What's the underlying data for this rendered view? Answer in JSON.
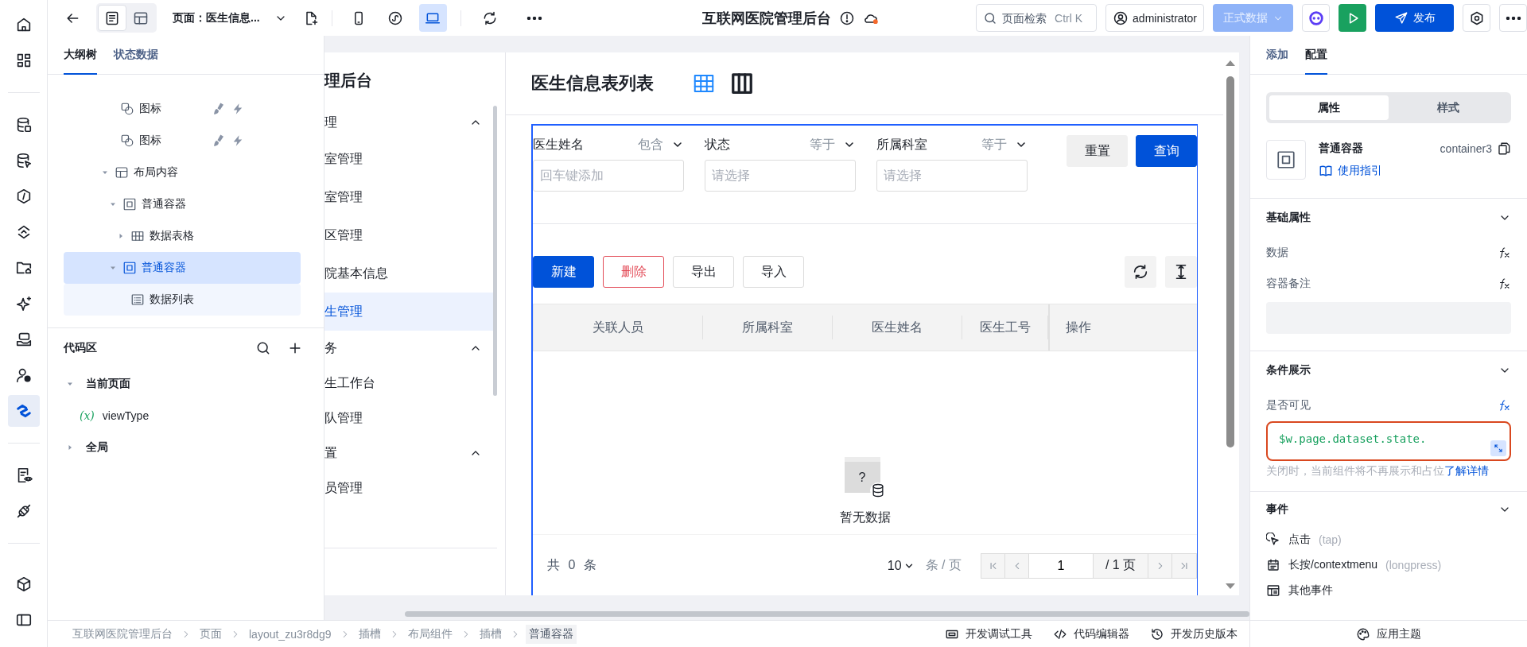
{
  "rail": {
    "groups": [
      [
        {
          "kind": "home",
          "selected": false
        },
        {
          "kind": "apps",
          "selected": false
        }
      ],
      [
        {
          "kind": "database",
          "selected": false
        },
        {
          "kind": "database-cursor",
          "selected": false
        },
        {
          "kind": "hexagon",
          "selected": false
        },
        {
          "kind": "api",
          "selected": false
        },
        {
          "kind": "folder",
          "selected": false
        },
        {
          "kind": "sparkle",
          "selected": false
        },
        {
          "kind": "hand",
          "selected": false
        },
        {
          "kind": "user",
          "selected": false
        },
        {
          "kind": "logic",
          "selected": true
        }
      ],
      [
        {
          "kind": "doc",
          "selected": false
        },
        {
          "kind": "plug",
          "selected": false
        }
      ],
      [
        {
          "kind": "cube",
          "selected": false
        },
        {
          "kind": "panel",
          "selected": false
        }
      ]
    ]
  },
  "topbar": {
    "view_modes": [
      {
        "kind": "outline",
        "selected": true
      },
      {
        "kind": "layout",
        "selected": false
      }
    ],
    "page_selector": "页面：医生信息...",
    "devices": [
      {
        "kind": "mobile",
        "selected": false
      },
      {
        "kind": "mini",
        "selected": false
      },
      {
        "kind": "desktop",
        "selected": true
      }
    ],
    "title": "互联网医院管理后台",
    "search": {
      "placeholder": "页面检索",
      "shortcut": "Ctrl K"
    },
    "user": "administrator",
    "env": {
      "label": "正式数据",
      "disabled": true
    },
    "publish": "发布"
  },
  "outline": {
    "tabs": [
      {
        "label": "大纲树",
        "selected": true
      },
      {
        "label": "状态数据",
        "selected": false
      }
    ],
    "scrolled_rows": [
      {
        "label": "图标",
        "kind": "icon",
        "selected": false
      },
      {
        "label": "图标",
        "kind": "icon",
        "selected": false
      }
    ],
    "tree": [
      {
        "label": "布局内容",
        "kind": "layout",
        "expanded": true,
        "selected": false,
        "children": [
          {
            "label": "普通容器",
            "kind": "container",
            "expanded": true,
            "selected": false,
            "children": [
              {
                "label": "数据表格",
                "kind": "table",
                "expanded": false,
                "selected": false
              }
            ]
          },
          {
            "label": "普通容器",
            "kind": "container",
            "expanded": true,
            "selected": true,
            "children": [
              {
                "label": "数据列表",
                "kind": "list",
                "selected": false
              }
            ]
          }
        ]
      }
    ],
    "code_area": {
      "title": "代码区",
      "groups": [
        {
          "label": "当前页面",
          "expanded": true,
          "variables": [
            {
              "badge": "(x)",
              "name": "viewType"
            }
          ]
        },
        {
          "label": "全局",
          "expanded": false
        }
      ]
    }
  },
  "preview": {
    "sidebar": {
      "title": "理后台",
      "items": [
        {
          "kind": "group",
          "label": "理",
          "expanded": true
        },
        {
          "kind": "link",
          "label": "室管理",
          "selected": false
        },
        {
          "kind": "link",
          "label": "室管理",
          "selected": false
        },
        {
          "kind": "link",
          "label": "区管理",
          "selected": false
        },
        {
          "kind": "link",
          "label": "院基本信息",
          "selected": false
        },
        {
          "kind": "link",
          "label": "生管理",
          "selected": true
        },
        {
          "kind": "group",
          "label": "务",
          "expanded": true
        },
        {
          "kind": "link",
          "label": "生工作台",
          "selected": false
        },
        {
          "kind": "link",
          "label": "队管理",
          "selected": false
        },
        {
          "kind": "group",
          "label": "置",
          "expanded": true
        },
        {
          "kind": "link",
          "label": "员管理",
          "selected": false
        }
      ]
    },
    "title": "医生信息表列表",
    "view_toggles": [
      {
        "kind": "grid",
        "selected": true
      },
      {
        "kind": "columns",
        "selected": false
      }
    ],
    "filters": [
      {
        "label": "医生姓名",
        "operator": "包含",
        "placeholder": "回车键添加"
      },
      {
        "label": "状态",
        "operator": "等于",
        "placeholder": "请选择"
      },
      {
        "label": "所属科室",
        "operator": "等于",
        "placeholder": "请选择"
      }
    ],
    "filter_buttons": [
      {
        "label": "重置",
        "kind": "default"
      },
      {
        "label": "查询",
        "kind": "primary"
      }
    ],
    "actions": [
      {
        "label": "新建",
        "kind": "primary"
      },
      {
        "label": "删除",
        "kind": "danger"
      },
      {
        "label": "导出",
        "kind": "default"
      },
      {
        "label": "导入",
        "kind": "default"
      }
    ],
    "columns": [
      {
        "label": "关联人员",
        "fixed": false
      },
      {
        "label": "所属科室",
        "fixed": false
      },
      {
        "label": "医生姓名",
        "fixed": false
      },
      {
        "label": "医生工号",
        "fixed": false
      },
      {
        "label": "操作",
        "fixed": true
      }
    ],
    "empty_mark": "?",
    "empty_text": "暂无数据",
    "total": "共 0 条",
    "page_size": "10",
    "page_size_unit": "条 / 页",
    "page": "1",
    "page_total": "/ 1 页"
  },
  "config": {
    "tabs": [
      {
        "label": "添加",
        "selected": false
      },
      {
        "label": "配置",
        "selected": true
      }
    ],
    "segments": [
      {
        "label": "属性",
        "selected": true
      },
      {
        "label": "样式",
        "selected": false
      }
    ],
    "component": {
      "name": "普通容器",
      "id": "container3",
      "guide": "使用指引"
    },
    "sections": [
      {
        "kind": "basic",
        "title": "基础属性",
        "props": [
          {
            "label": "数据",
            "bound": false
          },
          {
            "label": "容器备注",
            "bound": false
          }
        ]
      },
      {
        "kind": "condition",
        "title": "条件展示",
        "props": [
          {
            "label": "是否可见",
            "bound": true
          }
        ],
        "expression": "$w.page.dataset.state.",
        "help": "关闭时，当前组件将不再展示和占位",
        "help_link": "了解详情"
      },
      {
        "kind": "events",
        "title": "事件",
        "events": [
          {
            "kind": "tap",
            "name": "点击",
            "code": "(tap)"
          },
          {
            "kind": "longpress",
            "name": "长按/contextmenu",
            "code": "(longpress)"
          },
          {
            "kind": "other",
            "name": "其他事件"
          }
        ]
      }
    ]
  },
  "status_bar": {
    "breadcrumbs": [
      {
        "label": "互联网医院管理后台",
        "selected": false
      },
      {
        "label": "页面",
        "selected": false
      },
      {
        "label": "layout_zu3r8dg9",
        "selected": false
      },
      {
        "label": "插槽",
        "selected": false
      },
      {
        "label": "布局组件",
        "selected": false
      },
      {
        "label": "插槽",
        "selected": false
      },
      {
        "label": "普通容器",
        "selected": true
      }
    ],
    "tools": [
      {
        "kind": "debug",
        "label": "开发调试工具"
      },
      {
        "kind": "code",
        "label": "代码编辑器"
      },
      {
        "kind": "history",
        "label": "开发历史版本"
      }
    ],
    "theme": "应用主题"
  }
}
